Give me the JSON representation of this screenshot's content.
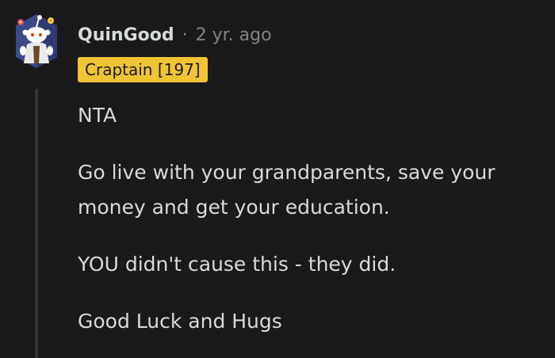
{
  "comment": {
    "username": "QuinGood",
    "separator": "·",
    "timestamp": "2 yr. ago",
    "flair": "Craptain [197]",
    "paragraphs": [
      "NTA",
      "Go live with your grandparents, save your money and get your education.",
      "YOU didn't cause this - they did.",
      "Good Luck and Hugs"
    ]
  },
  "colors": {
    "background": "#1a1a1b",
    "text": "#d7dadc",
    "muted": "#818384",
    "flair_bg": "#f0c435",
    "thread_line": "#343536"
  },
  "icons": {
    "avatar": "snoo-avatar-icon"
  }
}
